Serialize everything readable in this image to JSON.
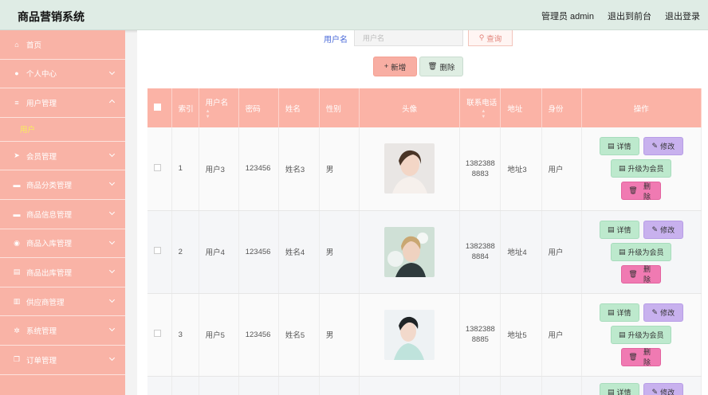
{
  "app": {
    "title": "商品营销系统"
  },
  "topbar": {
    "admin": "管理员 admin",
    "front": "退出到前台",
    "logout": "退出登录"
  },
  "sidebar": {
    "items": [
      {
        "label": "首页",
        "icon": "home-icon"
      },
      {
        "label": "个人中心",
        "icon": "user-icon"
      },
      {
        "label": "用户管理",
        "icon": "list-icon"
      },
      {
        "label": "会员管理",
        "icon": "send-icon"
      },
      {
        "label": "商品分类管理",
        "icon": "monitor-icon"
      },
      {
        "label": "商品信息管理",
        "icon": "message-icon"
      },
      {
        "label": "商品入库管理",
        "icon": "compass-icon"
      },
      {
        "label": "商品出库管理",
        "icon": "clipboard-icon"
      },
      {
        "label": "供应商管理",
        "icon": "bar-chart-icon"
      },
      {
        "label": "系统管理",
        "icon": "settings-icon"
      },
      {
        "label": "订单管理",
        "icon": "copy-icon"
      }
    ],
    "sub_active": "用户"
  },
  "search": {
    "label": "用户名",
    "placeholder": "用户名",
    "button": "查询"
  },
  "actions": {
    "add": "新增",
    "delete": "删除"
  },
  "table": {
    "headers": [
      "索引",
      "用户名",
      "密码",
      "姓名",
      "性别",
      "头像",
      "联系电话",
      "地址",
      "身份",
      "操作"
    ],
    "rows": [
      {
        "index": "1",
        "username": "用户3",
        "password": "123456",
        "name": "姓名3",
        "gender": "男",
        "phone1": "1382388",
        "phone2": "8883",
        "address": "地址3",
        "role": "用户"
      },
      {
        "index": "2",
        "username": "用户4",
        "password": "123456",
        "name": "姓名4",
        "gender": "男",
        "phone1": "1382388",
        "phone2": "8884",
        "address": "地址4",
        "role": "用户"
      },
      {
        "index": "3",
        "username": "用户5",
        "password": "123456",
        "name": "姓名5",
        "gender": "男",
        "phone1": "1382388",
        "phone2": "8885",
        "address": "地址5",
        "role": "用户"
      }
    ],
    "ops": {
      "detail": "详情",
      "edit": "修改",
      "upgrade": "升级为会员",
      "remove": "删除"
    }
  },
  "colors": {
    "sidebar": "#f9b3a6",
    "header": "#fbb3a6",
    "topbar": "#dfece5"
  }
}
